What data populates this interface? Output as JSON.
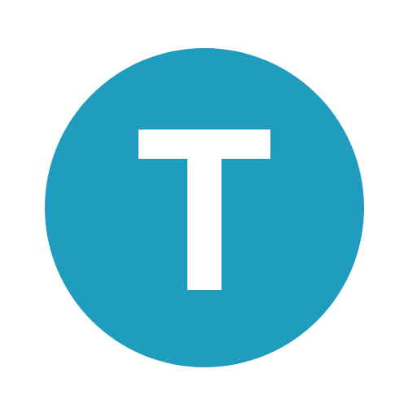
{
  "logo": {
    "letter": "T",
    "circle_color": "#209CBF",
    "letter_color": "#FFFFFF",
    "background_color": "#FFFFFF"
  }
}
